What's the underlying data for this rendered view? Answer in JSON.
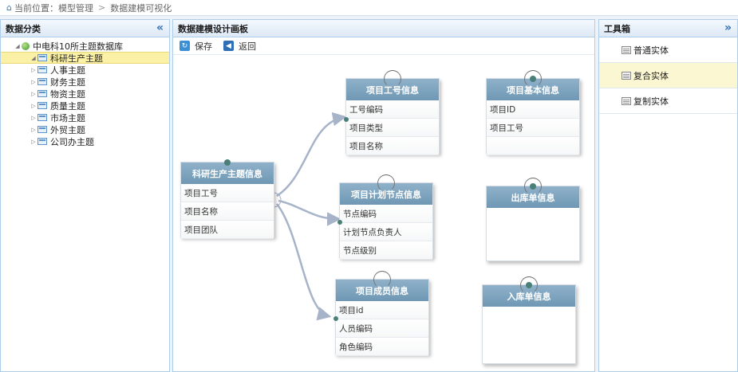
{
  "breadcrumb": {
    "label": "当前位置：",
    "items": [
      "模型管理",
      "数据建模可视化"
    ]
  },
  "left_panel": {
    "title": "数据分类",
    "collapse_glyph": "«",
    "root": "中电科10所主题数据库",
    "items": [
      {
        "label": "科研生产主题",
        "selected": true
      },
      {
        "label": "人事主题"
      },
      {
        "label": "财务主题"
      },
      {
        "label": "物资主题"
      },
      {
        "label": "质量主题"
      },
      {
        "label": "市场主题"
      },
      {
        "label": "外贸主题"
      },
      {
        "label": "公司办主题"
      }
    ]
  },
  "center_panel": {
    "title": "数据建模设计画板",
    "toolbar": {
      "save": "保存",
      "back": "返回"
    }
  },
  "entities": {
    "main": {
      "title": "科研生产主题信息",
      "fields": [
        "项目工号",
        "项目名称",
        "项目团队"
      ]
    },
    "gonghao": {
      "title": "项目工号信息",
      "fields": [
        "工号编码",
        "项目类型",
        "项目名称"
      ]
    },
    "jiben": {
      "title": "项目基本信息",
      "fields": [
        "项目ID",
        "项目工号",
        ""
      ]
    },
    "jiedian": {
      "title": "项目计划节点信息",
      "fields": [
        "节点编码",
        "计划节点负责人",
        "节点级别"
      ]
    },
    "chuku": {
      "title": "出库单信息",
      "fields": []
    },
    "chengyuan": {
      "title": "项目成员信息",
      "fields": [
        "项目id",
        "人员编码",
        "角色编码"
      ]
    },
    "ruku": {
      "title": "入库单信息",
      "fields": []
    }
  },
  "right_panel": {
    "title": "工具箱",
    "collapse_glyph": "»",
    "tools": [
      "普通实体",
      "复合实体",
      "复制实体"
    ]
  },
  "colors": {
    "entity_header": "#7ba2be",
    "link": "#a7b3c8",
    "selected": "#fbf1a6",
    "panel_border": "#aecde9"
  }
}
